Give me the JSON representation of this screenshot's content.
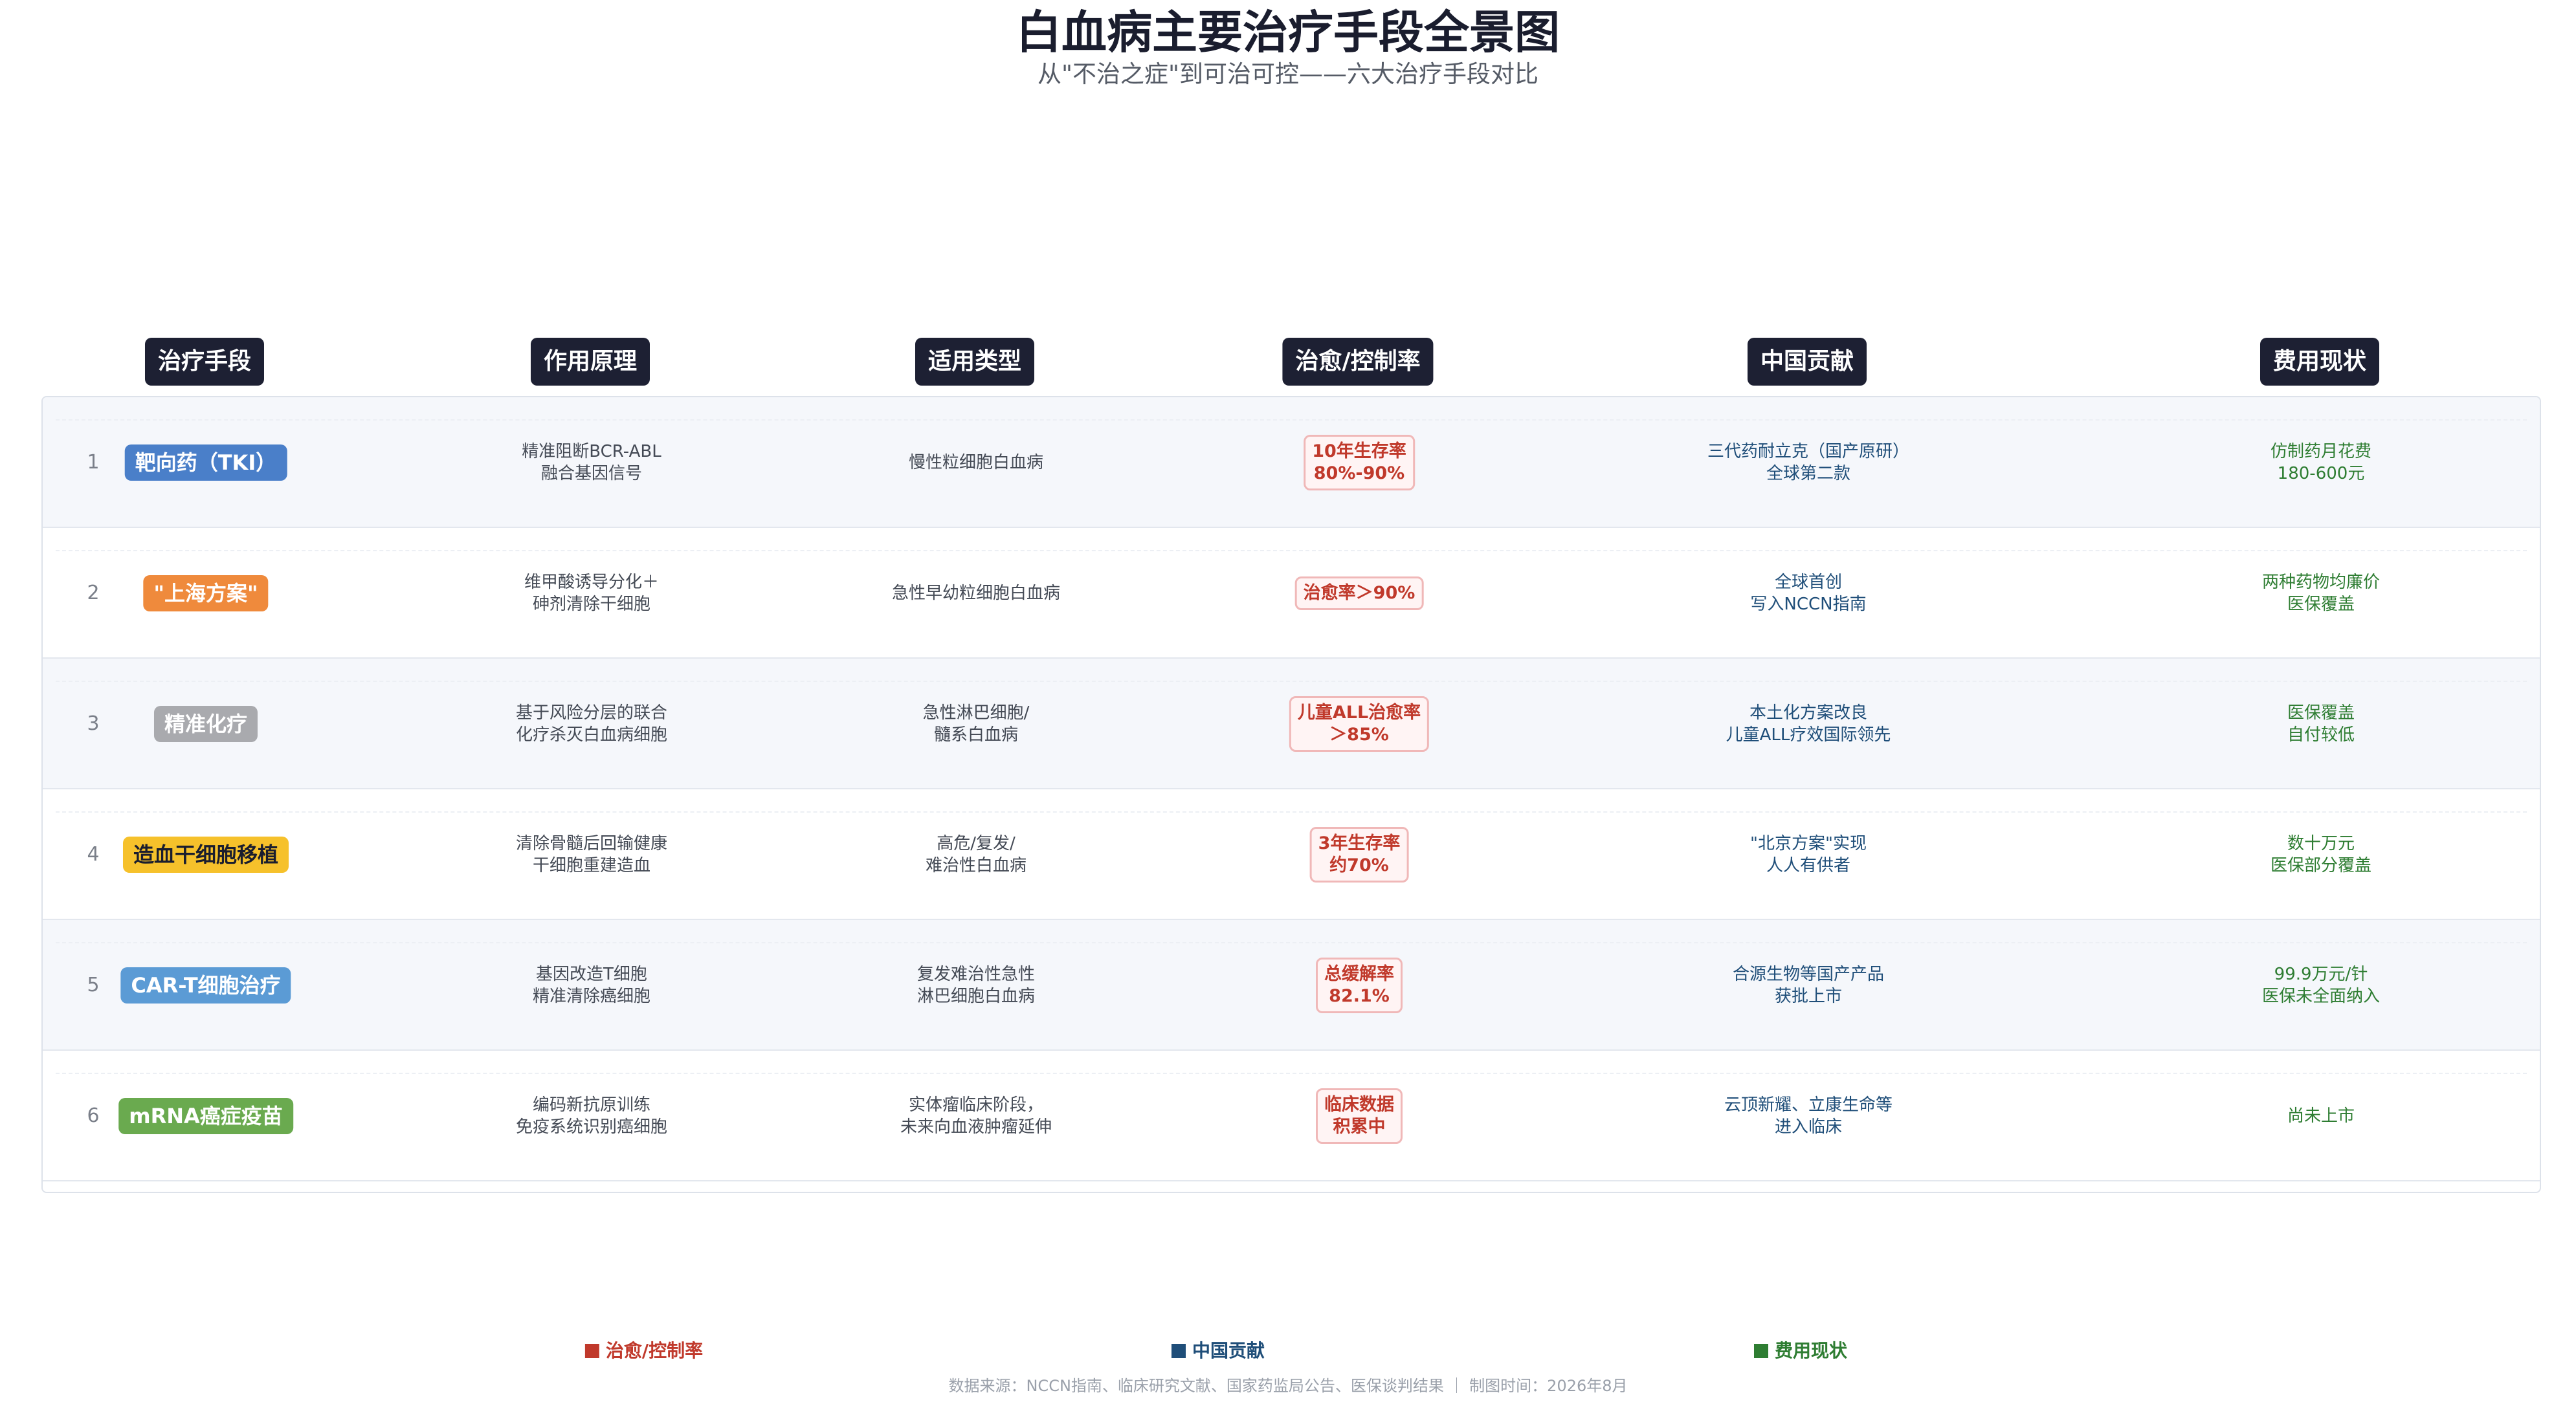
{
  "title": "白血病主要治疗手段全景图",
  "subtitle": "从\"不治之症\"到可治可控——六大治疗手段对比",
  "headers": [
    "治疗手段",
    "作用原理",
    "适用类型",
    "治愈/控制率",
    "中国贡献",
    "费用现状"
  ],
  "rows": [
    {
      "num": "1",
      "name": "靶向药（TKI）",
      "name_color": "#4a7fc9",
      "mechanism": [
        "精准阻断BCR-ABL",
        "融合基因信号"
      ],
      "type": [
        "慢性粒细胞白血病"
      ],
      "rate": [
        "10年生存率",
        "80%-90%"
      ],
      "china": [
        "三代药耐立克（国产原研）",
        "全球第二款"
      ],
      "cost": [
        "仿制药月花费",
        "180-600元"
      ]
    },
    {
      "num": "2",
      "name": "\"上海方案\"",
      "name_color": "#ef8a3c",
      "mechanism": [
        "维甲酸诱导分化＋",
        "砷剂清除干细胞"
      ],
      "type": [
        "急性早幼粒细胞白血病"
      ],
      "rate": [
        "治愈率＞90%"
      ],
      "china": [
        "全球首创",
        "写入NCCN指南"
      ],
      "cost": [
        "两种药物均廉价",
        "医保覆盖"
      ]
    },
    {
      "num": "3",
      "name": "精准化疗",
      "name_color": "#a9aaae",
      "mechanism": [
        "基于风险分层的联合",
        "化疗杀灭白血病细胞"
      ],
      "type": [
        "急性淋巴细胞/",
        "髓系白血病"
      ],
      "rate": [
        "儿童ALL治愈率",
        "＞85%"
      ],
      "china": [
        "本土化方案改良",
        "儿童ALL疗效国际领先"
      ],
      "cost": [
        "医保覆盖",
        "自付较低"
      ]
    },
    {
      "num": "4",
      "name": "造血干细胞移植",
      "name_color": "#f6c12b",
      "mechanism": [
        "清除骨髓后回输健康",
        "干细胞重建造血"
      ],
      "type": [
        "高危/复发/",
        "难治性白血病"
      ],
      "rate": [
        "3年生存率",
        "约70%"
      ],
      "china": [
        "\"北京方案\"实现",
        "人人有供者"
      ],
      "cost": [
        "数十万元",
        "医保部分覆盖"
      ]
    },
    {
      "num": "5",
      "name": "CAR-T细胞治疗",
      "name_color": "#5b9bd5",
      "mechanism": [
        "基因改造T细胞",
        "精准清除癌细胞"
      ],
      "type": [
        "复发难治性急性",
        "淋巴细胞白血病"
      ],
      "rate": [
        "总缓解率",
        "82.1%"
      ],
      "china": [
        "合源生物等国产产品",
        "获批上市"
      ],
      "cost": [
        "99.9万元/针",
        "医保未全面纳入"
      ]
    },
    {
      "num": "6",
      "name": "mRNA癌症疫苗",
      "name_color": "#6aaa4f",
      "mechanism": [
        "编码新抗原训练",
        "免疫系统识别癌细胞"
      ],
      "type": [
        "实体瘤临床阶段，",
        "未来向血液肿瘤延伸"
      ],
      "rate": [
        "临床数据",
        "积累中"
      ],
      "china": [
        "云顶新耀、立康生命等",
        "进入临床"
      ],
      "cost": [
        "尚未上市"
      ]
    }
  ],
  "legend": [
    {
      "label": "治愈/控制率",
      "color": "#c0392b"
    },
    {
      "label": "中国贡献",
      "color": "#1f4e79"
    },
    {
      "label": "费用现状",
      "color": "#2e7d32"
    }
  ],
  "footer": "数据来源：NCCN指南、临床研究文献、国家药监局公告、医保谈判结果 ｜ 制图时间：2026年8月"
}
